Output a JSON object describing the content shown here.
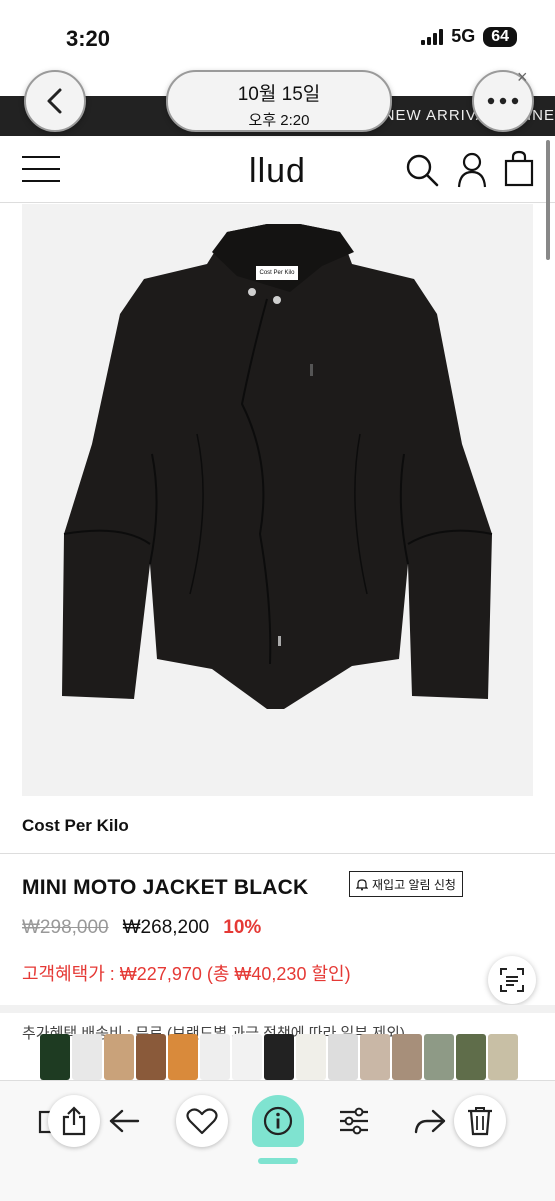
{
  "status_bar": {
    "time": "3:20",
    "network": "5G",
    "battery": "64"
  },
  "banner": {
    "text": "NEW ARRIVAL ·  WINE"
  },
  "overlay": {
    "date": "10월 15일",
    "time": "오후 2:20",
    "close": "×"
  },
  "header": {
    "logo": "llud"
  },
  "product": {
    "brand": "Cost Per Kilo",
    "label_text": "Cost Per Kilo",
    "name": "MINI MOTO JACKET BLACK",
    "notify_button": "재입고 알림 신청",
    "original_price": "₩298,000",
    "price": "₩268,200",
    "discount": "10%",
    "member_benefit": "고객혜택가 : ₩227,970 (총 ₩40,230 할인)",
    "extra_info": "추가혜택      배송비 : 무료 (브랜드별 과금 정책에 따라 일부 제외)"
  },
  "colors": {
    "accent": "#e53935",
    "banner_bg": "#222222",
    "text": "#111111"
  },
  "icons": [
    "back-icon",
    "more-icon",
    "menu-icon",
    "search-icon",
    "user-icon",
    "cart-icon",
    "notify-bell-icon",
    "scan-text-icon",
    "copy-icon",
    "share-icon",
    "arrow-left-icon",
    "heart-icon",
    "info-icon",
    "adjust-icon",
    "forward-icon",
    "trash-icon"
  ]
}
